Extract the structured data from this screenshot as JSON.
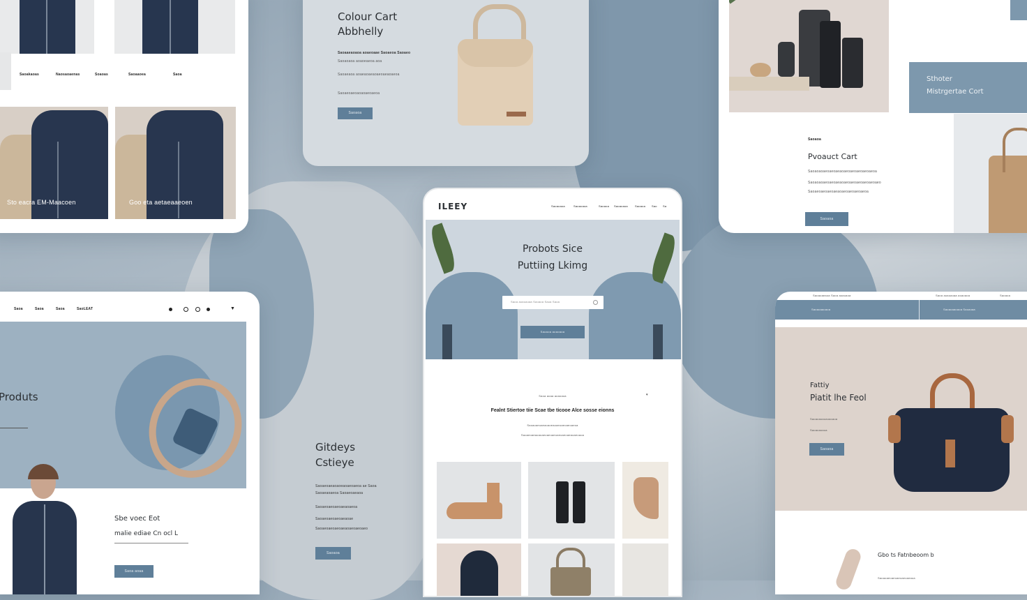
{
  "colors": {
    "accent": "#5f7f99",
    "background": "#9fb0be",
    "panel_blue": "#7d98ad",
    "navy": "#26344f",
    "beige": "#cdb89d"
  },
  "card_coats": {
    "nav": [
      "Saoakaoas",
      "Naosaoaenas",
      "Soaoas",
      "Saoaaoea",
      "Saoa"
    ],
    "captions": [
      "Sto eacra EM-Maacoen",
      "Goo eta aetaeaaeoen"
    ]
  },
  "card_bag": {
    "title_line1": "Colour Cart",
    "title_line2": "Abbhelly",
    "subtitle": "Saoaaeaoaoa aoaeoaae Saoaeoa Saoaeo",
    "lines": [
      "Saoaoaoa aoaoeaeoa aoa",
      "Saoaeaoa aoaeaoaeaoaeoaeaoaeoa",
      "Saoaeoaeoaoaoaeoaeoa"
    ],
    "button": "Saoaoa"
  },
  "card_kitchen": {
    "panel_line1": "Sthoter",
    "panel_line2": "Mistrgertae Cort",
    "kicker": "Saoaoa",
    "title": "Pvoauct Cart",
    "lines": [
      "Saoaoaoaeoaeoaeaoaeoaeoaeoaeoaeoa",
      "Saoaoaoaeoaeoaeaoaeoaeoaeoaeoaeoaeo",
      "Saoaeoaeoaeoaeaoaeoaeoaeoaeoa"
    ],
    "button": "Saoaoa"
  },
  "card_products": {
    "nav": [
      "Saoa",
      "Saoa",
      "Saoa",
      "SaoLEAT"
    ],
    "nav_icons": [
      "dot-icon",
      "search-icon",
      "user-icon",
      "heart-icon",
      "cart-icon"
    ],
    "title": "Produts",
    "promo_line1": "Sbe voec Eot",
    "promo_line2": "malie ediae Cn ocl L",
    "button": "Saoa aoaa"
  },
  "mid_text": {
    "title_line1": "Gitdeys",
    "title_line2": "Cstieye",
    "lines": [
      "Saoaeoaeaoaoeaoaeoaeoa ae Saoa",
      "Saoaeaoaeoa Saoaeoaeaoa",
      "Saoaeoaeoaeoaeaoaeoa",
      "Saoaeoaeoaeoaeaoae",
      "Saoaeoaeoaeoaeaoaeoaeoaeo"
    ],
    "button": "Saoaoa"
  },
  "phone": {
    "logo": "ILEEY",
    "nav": [
      "Saoaoaoa",
      "Saoaoaoa",
      "Saoaoa",
      "Saoaoaoa",
      "Saoaoa",
      "Sao",
      "Sa"
    ],
    "hero_line1": "Probots Sice",
    "hero_line2": "Puttiing Lkimg",
    "search_placeholder": "Saoa aoaoaoaa Saoaoa Saoa Saoa",
    "cta": "Saoaoa aoaoaoa",
    "kicker": "Saoa aoaa aoaoaoa",
    "headline": "Fealnt Stiertoe tiie Scae tbe ticooe Alce sosse eionns",
    "lines": [
      "Saoaoaeoaeaoaoeaoaeoaeoaeoaeoa",
      "Saoaeoaeaoaoaeoaeoaeoaeoaeoaeaoaeoaoa"
    ]
  },
  "card_tote": {
    "topbar": [
      "Saoaoaeaoa Saoa aoaoaoa",
      "Saoa aoaoaoaa aoaoaoa",
      "Saoaoa"
    ],
    "tabs": [
      "Saoaoaaoaoa",
      "Saoaoaaoaoa Saoaoaa"
    ],
    "kicker": "Fattiy",
    "title": "Piatit lhe Feol",
    "lines": [
      "Saoaoaoaoaoaoaoa",
      "Saoaoaoaoa"
    ],
    "button": "Saoaoa",
    "bottom_title": "Gbo ts Fatnbeoom b",
    "bottom_line": "Saoaoaeoaeoaeoaeoaeaoa"
  }
}
